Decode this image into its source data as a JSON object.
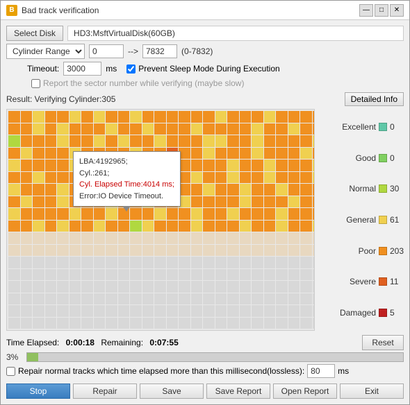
{
  "window": {
    "title": "Bad track verification",
    "icon": "B"
  },
  "title_controls": {
    "minimize": "—",
    "maximize": "□",
    "close": "✕"
  },
  "toolbar": {
    "select_disk_label": "Select Disk",
    "disk_value": "HD3:MsftVirtualDisk(60GB)",
    "cylinder_range_label": "Cylinder Range",
    "cylinder_start": "0",
    "arrow": "-->",
    "cylinder_end": "7832",
    "cylinder_hint": "(0-7832)",
    "timeout_label": "Timeout:",
    "timeout_value": "3000",
    "timeout_unit": "ms",
    "prevent_sleep_label": "Prevent Sleep Mode During Execution",
    "prevent_sleep_checked": true,
    "sector_report_label": "Report the sector number while verifying (maybe slow)",
    "sector_report_checked": false
  },
  "result": {
    "label": "Result: Verifying Cylinder:305",
    "detailed_btn": "Detailed Info"
  },
  "tooltip": {
    "line1": "LBA:4192965;",
    "line2": "Cyl.:261;",
    "line3": "Cyl. Elapsed Time:4014 ms;",
    "line4": "Error:IO Device Timeout."
  },
  "stats": [
    {
      "label": "Excellent",
      "color": "#60c8a8",
      "count": "0"
    },
    {
      "label": "Good",
      "color": "#80d060",
      "count": "0"
    },
    {
      "label": "Normal",
      "color": "#b0d840",
      "count": "30"
    },
    {
      "label": "General",
      "color": "#f0d050",
      "count": "61"
    },
    {
      "label": "Poor",
      "color": "#f09020",
      "count": "203"
    },
    {
      "label": "Severe",
      "color": "#e06020",
      "count": "11"
    },
    {
      "label": "Damaged",
      "color": "#c02020",
      "count": "5"
    }
  ],
  "bottom": {
    "time_elapsed_label": "Time Elapsed:",
    "time_elapsed_value": "0:00:18",
    "remaining_label": "Remaining:",
    "remaining_value": "0:07:55",
    "reset_btn": "Reset",
    "progress_pct": "3%",
    "repair_label": "Repair normal tracks which time elapsed more than this millisecond(lossless):",
    "repair_ms_value": "80",
    "repair_ms_unit": "ms",
    "repair_checked": false
  },
  "footer_buttons": {
    "stop": "Stop",
    "repair": "Repair",
    "save": "Save",
    "save_report": "Save Report",
    "open_report": "Open Report",
    "exit": "Exit"
  },
  "grid": {
    "colors": {
      "excellent": "#60c8a8",
      "good": "#80d060",
      "normal": "#b0d840",
      "general": "#f0d050",
      "poor": "#f09020",
      "severe": "#e06020",
      "damaged": "#c02020",
      "empty": "#d8d8d8",
      "light": "#e8d8c0"
    }
  }
}
